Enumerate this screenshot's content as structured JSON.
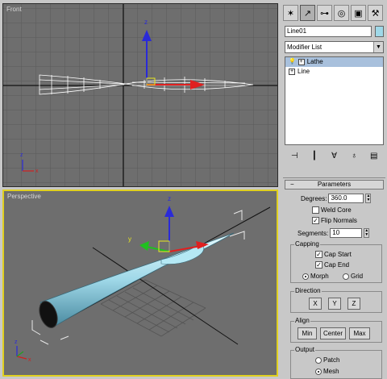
{
  "viewports": {
    "front_label": "Front",
    "perspective_label": "Perspective",
    "axis_z": "z",
    "axis_x": "x",
    "axis_y": "y"
  },
  "command_panel": {
    "tab_icons": [
      "create-icon",
      "modify-icon",
      "hierarchy-icon",
      "motion-icon",
      "display-icon",
      "utilities-icon"
    ],
    "tab_glyphs": [
      "✶",
      "↗",
      "⊶",
      "◎",
      "▣",
      "⚒"
    ],
    "object_name": "Line01",
    "object_color": "#9fd8e8",
    "modifier_list": "Modifier List",
    "stack": [
      {
        "label": "Lathe",
        "icon": "💡",
        "selected": true
      },
      {
        "label": "Line",
        "selected": false
      }
    ],
    "stack_tools": [
      "pin-stack-icon",
      "show-end-result-icon",
      "make-unique-icon",
      "remove-modifier-icon",
      "configure-sets-icon"
    ],
    "stack_tool_glyphs": [
      "⊣",
      "┃",
      "∀",
      "♁",
      "▤"
    ]
  },
  "parameters": {
    "title": "Parameters",
    "collapse": "−",
    "degrees_label": "Degrees:",
    "degrees_value": "360.0",
    "weld_core_label": "Weld Core",
    "weld_core": false,
    "flip_normals_label": "Flip Normals",
    "flip_normals": true,
    "segments_label": "Segments:",
    "segments_value": "10",
    "capping_label": "Capping",
    "cap_start_label": "Cap Start",
    "cap_start": true,
    "cap_end_label": "Cap End",
    "cap_end": true,
    "morph_label": "Morph",
    "grid_label": "Grid",
    "capping_mode": "Morph",
    "direction_label": "Direction",
    "dir_x": "X",
    "dir_y": "Y",
    "dir_z": "Z",
    "align_label": "Align",
    "align_min": "Min",
    "align_center": "Center",
    "align_max": "Max",
    "output_label": "Output",
    "patch_label": "Patch",
    "mesh_label": "Mesh",
    "output_mode": "Mesh"
  }
}
